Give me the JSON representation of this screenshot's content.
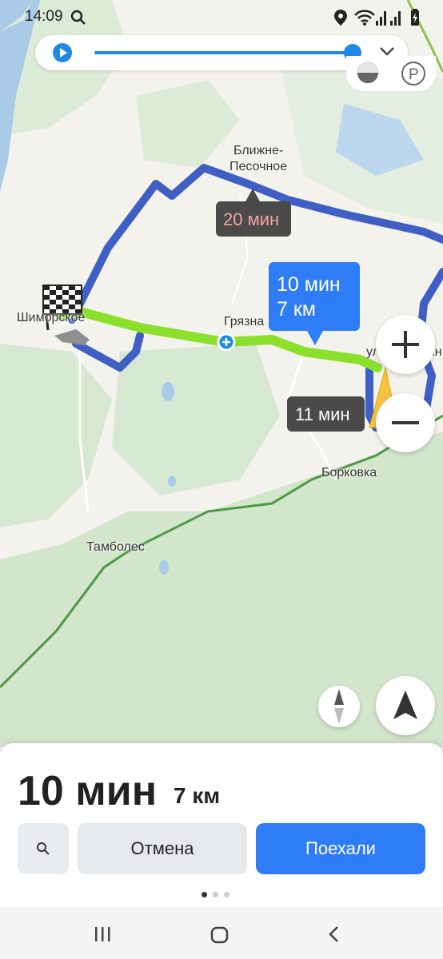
{
  "status_bar": {
    "time": "14:09"
  },
  "map": {
    "places": {
      "blizhne": "Ближне-",
      "pesochnoe": "Песочное",
      "shimorskoe": "Шиморское",
      "gryazna": "Грязна",
      "chelyuskin": "ул.Челюскин",
      "borkovka": "Борковка",
      "tambolec": "Тамболес"
    },
    "route_badges": {
      "alt1_time": "20 мин",
      "main_time": "10 мин",
      "main_dist": "7 км",
      "alt2_time": "11 мин"
    },
    "colors": {
      "main_route": "#8be02c",
      "alt_route": "#3f5fc4",
      "accent": "#2f7df6"
    }
  },
  "panel": {
    "eta_time": "10 мин",
    "eta_distance": "7 км",
    "cancel_label": "Отмена",
    "go_label": "Поехали",
    "pager_active": 1,
    "pager_total": 3
  }
}
